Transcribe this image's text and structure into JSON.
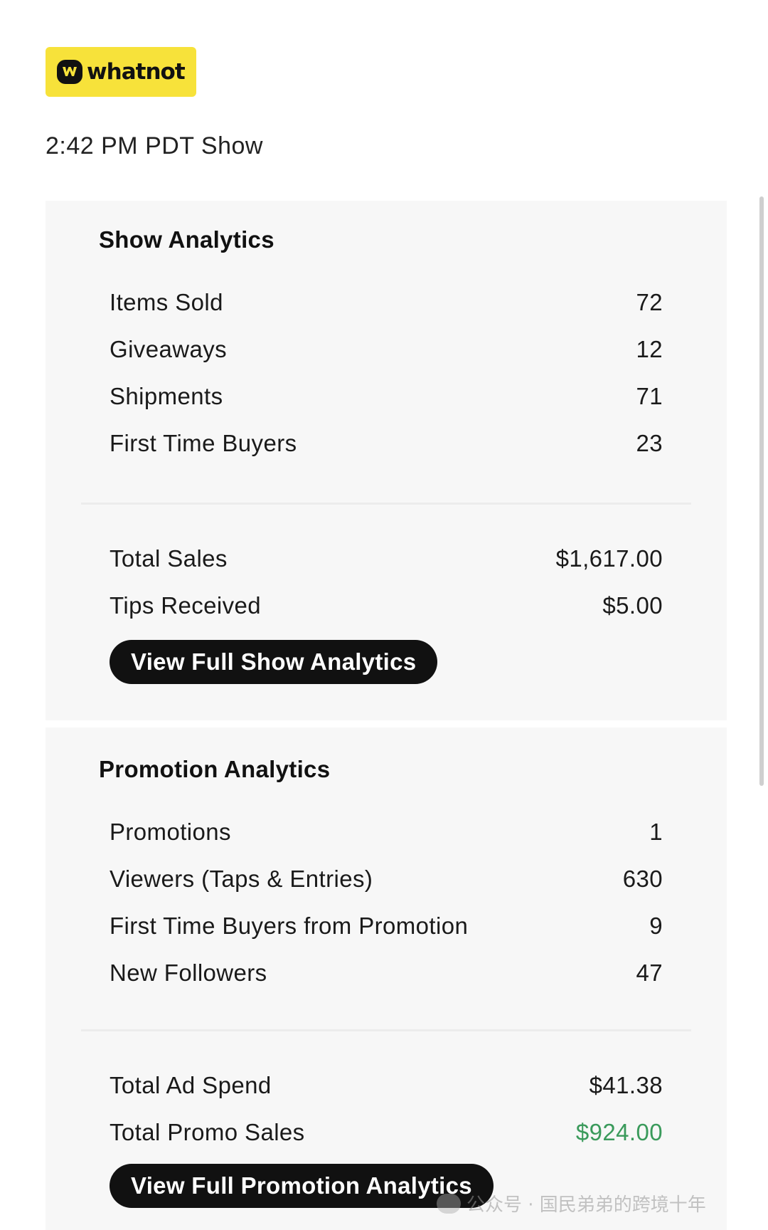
{
  "brand": {
    "name": "whatnot",
    "logo_bg": "#f7e23a"
  },
  "show_title": "2:42 PM PDT Show",
  "show_analytics": {
    "title": "Show Analytics",
    "stats": [
      {
        "label": "Items Sold",
        "value": "72"
      },
      {
        "label": "Giveaways",
        "value": "12"
      },
      {
        "label": "Shipments",
        "value": "71"
      },
      {
        "label": "First Time Buyers",
        "value": "23"
      }
    ],
    "totals": [
      {
        "label": "Total Sales",
        "value": "$1,617.00"
      },
      {
        "label": "Tips Received",
        "value": "$5.00"
      }
    ],
    "button_label": "View Full Show Analytics"
  },
  "promotion_analytics": {
    "title": "Promotion Analytics",
    "stats": [
      {
        "label": "Promotions",
        "value": "1"
      },
      {
        "label": "Viewers (Taps & Entries)",
        "value": "630"
      },
      {
        "label": "First Time Buyers from Promotion",
        "value": "9"
      },
      {
        "label": "New Followers",
        "value": "47"
      }
    ],
    "totals": [
      {
        "label": "Total Ad Spend",
        "value": "$41.38"
      },
      {
        "label": "Total Promo Sales",
        "value": "$924.00",
        "color": "#3a9a5b"
      }
    ],
    "button_label": "View Full Promotion Analytics"
  },
  "watermark": "公众号 · 国民弟弟的跨境十年",
  "colors": {
    "card_bg": "#f7f7f7",
    "button_bg": "#111111",
    "positive": "#3a9a5b"
  }
}
